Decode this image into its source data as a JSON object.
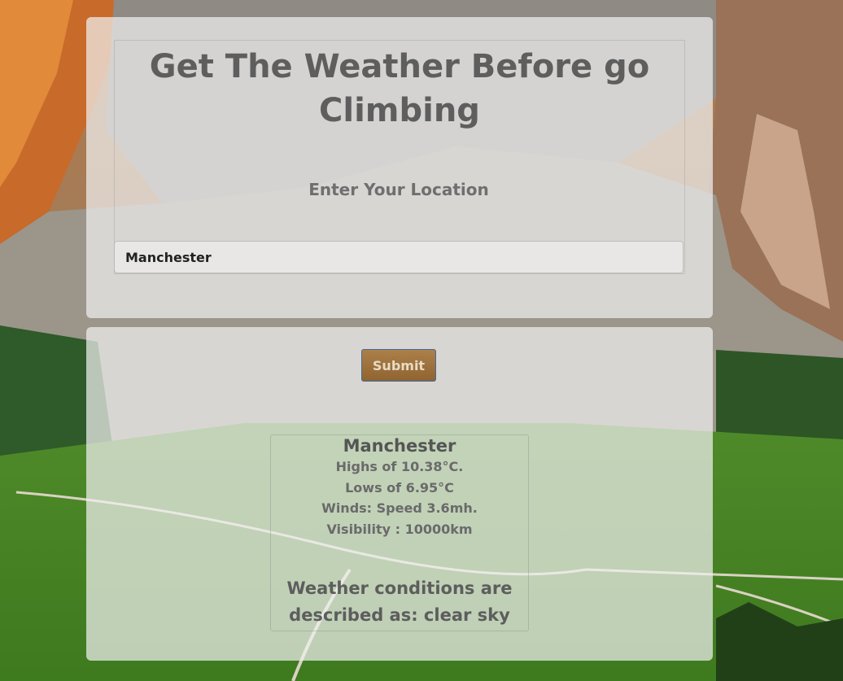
{
  "page": {
    "title": "Get The Weather Before go Climbing"
  },
  "form": {
    "location_label": "Enter Your Location",
    "location_value": "Manchester",
    "submit_label": "Submit"
  },
  "result": {
    "city": "Manchester",
    "highs": "Highs of 10.38°C.",
    "lows": "Lows of 6.95°C",
    "winds": "Winds: Speed 3.6mh.",
    "visibility": "Visibility : 10000km",
    "conditions": "Weather conditions are described as: clear sky"
  },
  "colors": {
    "title_text": "#5e5e5e",
    "button_bg": "#9a6a30",
    "button_border": "#3a5f9a",
    "card_bg": "rgba(240,240,240,0.72)"
  }
}
